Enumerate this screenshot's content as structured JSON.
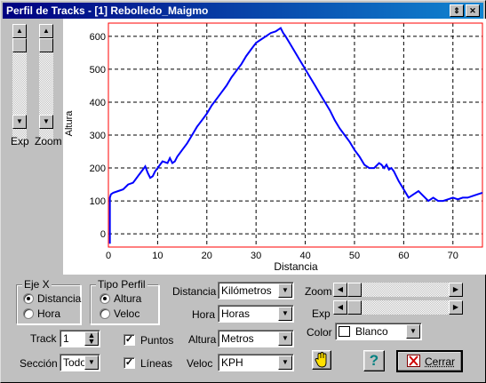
{
  "window": {
    "title": "Perfil de Tracks - [1] Rebolledo_Maigmo",
    "btn_restore": "⇕",
    "btn_close": "✕"
  },
  "sliders": {
    "exp_label": "Exp",
    "zoom_label": "Zoom"
  },
  "chart_data": {
    "type": "line",
    "xlabel": "Distancia",
    "ylabel": "Altura",
    "xlim": [
      0,
      76
    ],
    "ylim": [
      -40,
      640
    ],
    "x_ticks": [
      0,
      10,
      20,
      30,
      40,
      50,
      60,
      70
    ],
    "y_ticks": [
      0,
      100,
      200,
      300,
      400,
      500,
      600
    ],
    "grid": true,
    "series": [
      {
        "color": "#0000ff",
        "x": [
          0.3,
          0.5,
          1,
          2,
          3,
          4,
          5,
          5.5,
          6,
          6.5,
          7,
          7.5,
          8,
          8.5,
          9,
          9.5,
          10,
          11,
          12,
          12.5,
          13,
          13.5,
          14,
          15,
          16,
          17,
          18,
          19,
          20,
          21,
          22,
          23,
          24,
          25,
          26,
          27,
          28,
          29,
          30,
          31,
          32,
          33,
          34,
          34.5,
          35,
          35.5,
          36,
          37,
          38,
          39,
          40,
          41,
          42,
          43,
          44,
          45,
          46,
          47,
          48,
          49,
          50,
          51,
          52,
          53,
          54,
          55,
          55.5,
          56,
          56.5,
          57,
          57.5,
          58,
          59,
          60,
          61,
          62,
          63,
          64,
          65,
          66,
          67,
          68,
          69,
          70,
          71,
          72,
          73,
          74,
          75,
          76
        ],
        "y": [
          110,
          120,
          125,
          130,
          135,
          150,
          155,
          165,
          175,
          185,
          195,
          205,
          185,
          170,
          175,
          190,
          200,
          220,
          215,
          230,
          215,
          220,
          235,
          255,
          275,
          300,
          325,
          345,
          365,
          390,
          410,
          430,
          450,
          475,
          495,
          515,
          540,
          560,
          580,
          590,
          600,
          610,
          615,
          620,
          625,
          610,
          600,
          575,
          550,
          525,
          500,
          475,
          450,
          425,
          400,
          375,
          345,
          320,
          300,
          280,
          255,
          235,
          210,
          200,
          200,
          215,
          210,
          200,
          210,
          195,
          200,
          190,
          160,
          135,
          110,
          120,
          130,
          115,
          100,
          110,
          100,
          100,
          105,
          110,
          105,
          110,
          110,
          115,
          120,
          125
        ]
      }
    ]
  },
  "controls": {
    "eje_x": {
      "title": "Eje X",
      "opt_distancia": "Distancia",
      "opt_hora": "Hora",
      "selected": "Distancia"
    },
    "tipo_perfil": {
      "title": "Tipo Perfil",
      "opt_altura": "Altura",
      "opt_veloc": "Veloc",
      "selected": "Altura"
    },
    "track_label": "Track",
    "track_value": "1",
    "seccion_label": "Sección",
    "seccion_value": "Todo",
    "puntos_label": "Puntos",
    "lineas_label": "Líneas",
    "distancia_label": "Distancia",
    "distancia_value": "Kilómetros",
    "hora_label": "Hora",
    "hora_value": "Horas",
    "altura_label": "Altura",
    "altura_value": "Metros",
    "veloc_label": "Veloc",
    "veloc_value": "KPH",
    "zoom_label": "Zoom",
    "exp_label": "Exp",
    "color_label": "Color",
    "color_value": "Blanco",
    "help_glyph": "?",
    "cerrar_label": "Cerrar"
  }
}
